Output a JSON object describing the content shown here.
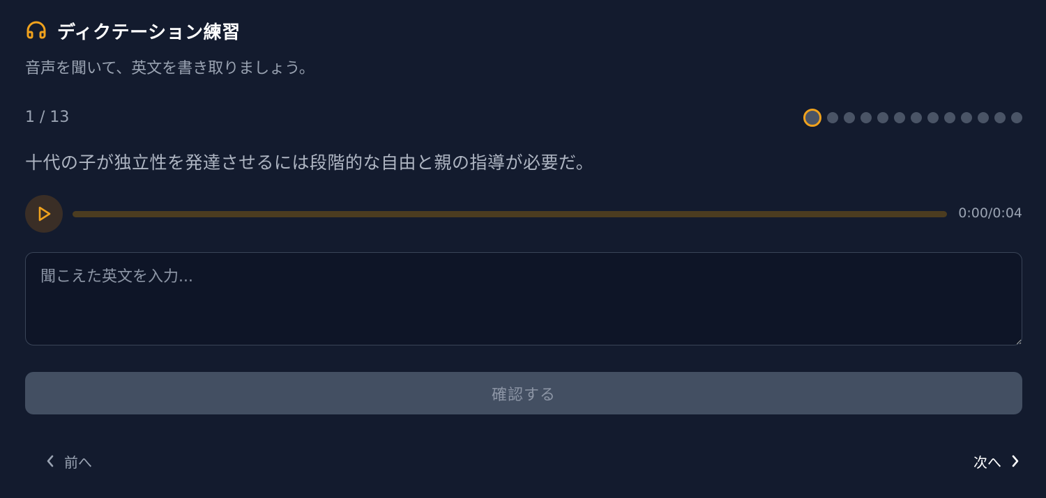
{
  "header": {
    "title": "ディクテーション練習",
    "subtitle": "音声を聞いて、英文を書き取りましょう。"
  },
  "progress": {
    "counter": "1 / 13",
    "current": 1,
    "total": 13
  },
  "exercise": {
    "sentence": "十代の子が独立性を発達させるには段階的な自由と親の指導が必要だ。"
  },
  "player": {
    "time": "0:00/0:04",
    "progress_fraction": 0
  },
  "answer": {
    "value": "",
    "placeholder": "聞こえた英文を入力..."
  },
  "actions": {
    "confirm_label": "確認する"
  },
  "nav": {
    "prev_label": "前へ",
    "next_label": "次へ"
  },
  "colors": {
    "accent": "#f0a21d",
    "background": "#131b2e",
    "dot_inactive": "#4a5466",
    "button_disabled": "#434f62"
  },
  "icons": {
    "header": "headphones-icon",
    "play": "play-icon",
    "prev": "chevron-left-icon",
    "next": "chevron-right-icon"
  }
}
